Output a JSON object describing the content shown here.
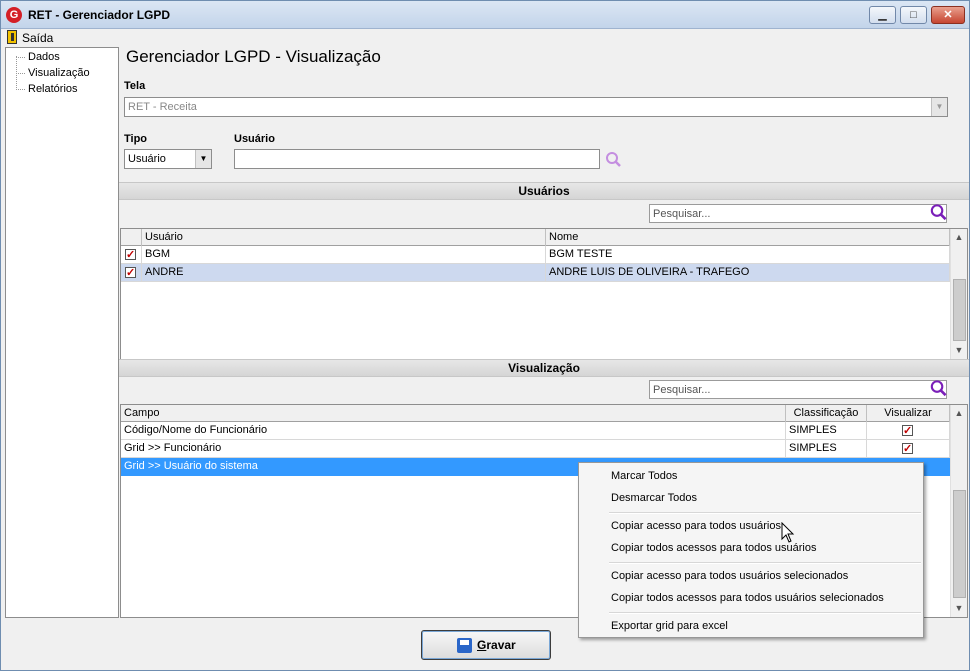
{
  "window": {
    "title": "RET - Gerenciador LGPD",
    "minimize_glyph": "▁",
    "maximize_glyph": "□",
    "close_glyph": "✕",
    "app_icon_letter": "G"
  },
  "menu": {
    "exit_label": "Saída"
  },
  "tree": {
    "items": [
      "Dados",
      "Visualização",
      "Relatórios"
    ]
  },
  "page": {
    "title": "Gerenciador LGPD - Visualização"
  },
  "form": {
    "tela_label": "Tela",
    "tela_value": "RET - Receita",
    "tipo_label": "Tipo",
    "tipo_value": "Usuário",
    "usuario_label": "Usuário",
    "usuario_value": ""
  },
  "users_section": {
    "header": "Usuários",
    "search_placeholder": "Pesquisar...",
    "columns": [
      "Usuário",
      "Nome"
    ],
    "rows": [
      {
        "checked": true,
        "usuario": "BGM",
        "nome": "BGM TESTE"
      },
      {
        "checked": true,
        "usuario": "ANDRE",
        "nome": "ANDRE LUIS DE OLIVEIRA - TRAFEGO"
      }
    ]
  },
  "visual_section": {
    "header": "Visualização",
    "search_placeholder": "Pesquisar...",
    "columns": [
      "Campo",
      "Classificação",
      "Visualizar"
    ],
    "rows": [
      {
        "campo": "Código/Nome do Funcionário",
        "classificacao": "SIMPLES",
        "visualizar": true
      },
      {
        "campo": "Grid >> Funcionário",
        "classificacao": "SIMPLES",
        "visualizar": true
      },
      {
        "campo": "Grid >> Usuário do sistema",
        "classificacao": "",
        "visualizar": false
      }
    ]
  },
  "context_menu": {
    "items": [
      "Marcar Todos",
      "Desmarcar Todos",
      "Copiar acesso para todos usuários",
      "Copiar todos acessos para todos usuários",
      "Copiar acesso para todos usuários selecionados",
      "Copiar todos acessos para todos usuários selecionados",
      "Exportar grid para excel"
    ]
  },
  "actions": {
    "save_first": "G",
    "save_rest": "ravar"
  },
  "colors": {
    "selection": "#3399ff",
    "selection_light": "#cdd9ef",
    "accent_icon": "#9b35c9",
    "check": "#c00000"
  }
}
